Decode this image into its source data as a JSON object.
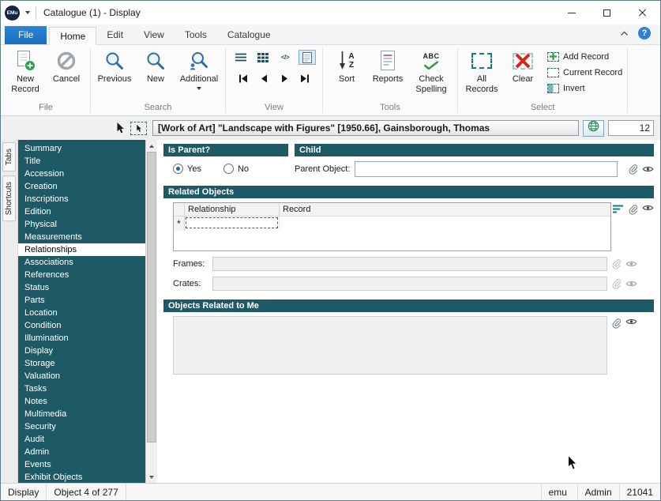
{
  "colors": {
    "accent_teal": "#1E5A66",
    "file_tab_blue": "#1779C8",
    "selection_teal": "#0F7C86",
    "clear_red": "#D6281A",
    "new_green": "#2AA14D"
  },
  "icons": {
    "code_view": "</>",
    "abc": "ABC",
    "sort_a": "A",
    "sort_z": "Z",
    "help": "?"
  },
  "titlebar": {
    "app_badge": "EMu",
    "title": "Catalogue (1) - Display"
  },
  "ribbon_tabs": [
    "File",
    "Home",
    "Edit",
    "View",
    "Tools",
    "Catalogue"
  ],
  "ribbon": {
    "file_group": {
      "label": "File",
      "new_record": "New Record",
      "cancel": "Cancel"
    },
    "search_group": {
      "label": "Search",
      "previous": "Previous",
      "new": "New",
      "additional": "Additional"
    },
    "view_group": {
      "label": "View"
    },
    "tools_group": {
      "label": "Tools",
      "sort": "Sort",
      "reports": "Reports",
      "check_spelling": "Check Spelling"
    },
    "select_group": {
      "label": "Select",
      "all_records": "All Records",
      "clear": "Clear",
      "add_record": "Add Record",
      "current_record": "Current Record",
      "invert": "Invert"
    }
  },
  "record_bar": {
    "title": "[Work of Art] \"Landscape with Figures\" [1950.66], Gainsborough, Thomas",
    "count": "12"
  },
  "tab_strip": {
    "tabs": "Tabs",
    "shortcuts": "Shortcuts"
  },
  "sidebar": {
    "selected": "Relationships",
    "items": [
      "Summary",
      "Title",
      "Accession",
      "Creation",
      "Inscriptions",
      "Edition",
      "Physical",
      "Measurements",
      "Relationships",
      "Associations",
      "References",
      "Status",
      "Parts",
      "Location",
      "Condition",
      "Illumination",
      "Display",
      "Storage",
      "Valuation",
      "Tasks",
      "Notes",
      "Multimedia",
      "Security",
      "Audit",
      "Admin",
      "Events",
      "Exhibit Objects"
    ]
  },
  "main": {
    "is_parent": {
      "header": "Is Parent?",
      "yes_label": "Yes",
      "no_label": "No",
      "selected": "Yes"
    },
    "child": {
      "header": "Child",
      "parent_object_label": "Parent Object:",
      "parent_object_value": ""
    },
    "related_objects": {
      "header": "Related Objects",
      "columns": [
        "Relationship",
        "Record"
      ],
      "new_row_marker": "*",
      "frames_label": "Frames:",
      "frames_value": "",
      "crates_label": "Crates:",
      "crates_value": ""
    },
    "objects_related_to_me": {
      "header": "Objects Related to Me",
      "value": ""
    }
  },
  "statusbar": {
    "mode": "Display",
    "record_position": "Object 4 of 277",
    "user": "emu",
    "group": "Admin",
    "session": "21041"
  }
}
